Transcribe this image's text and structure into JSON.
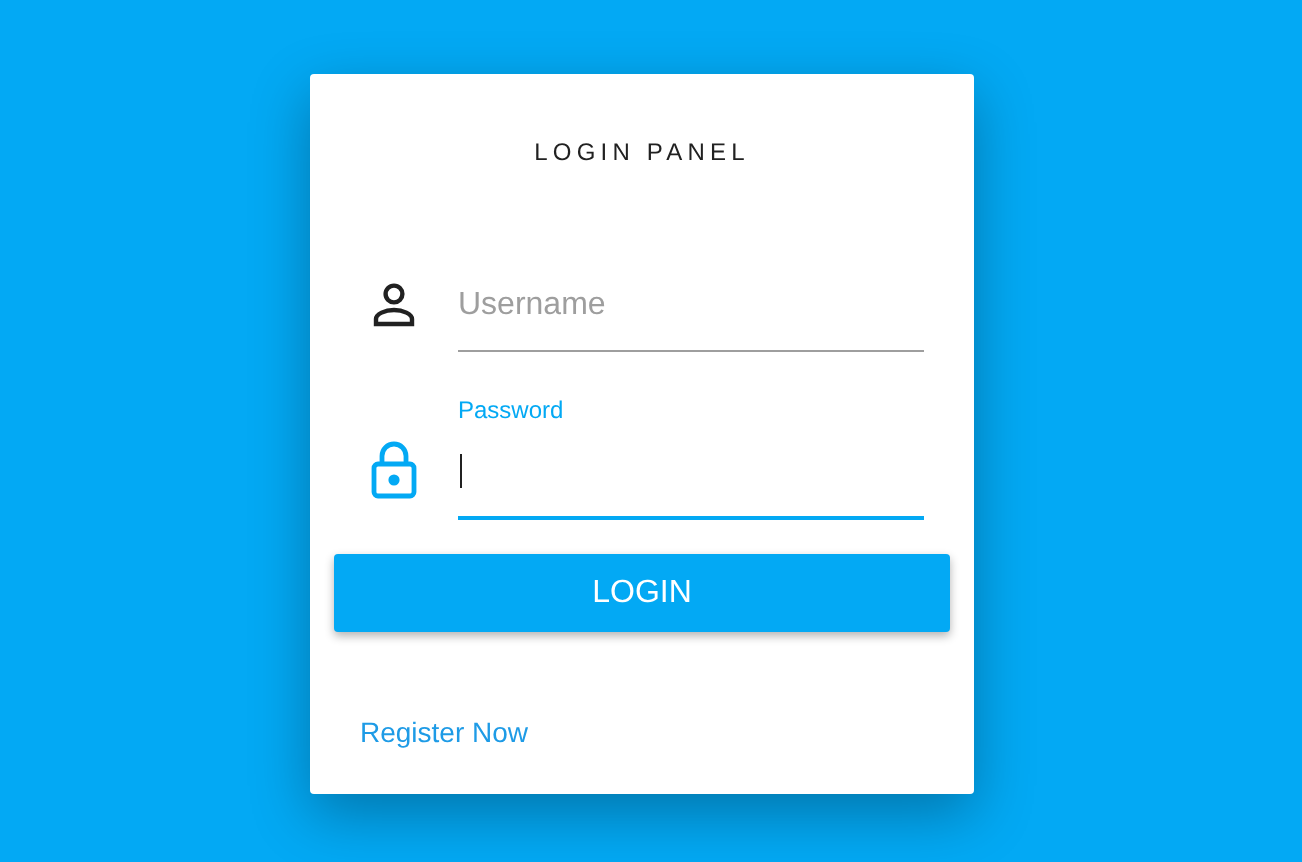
{
  "card": {
    "title": "LOGIN PANEL"
  },
  "fields": [
    {
      "kind": "user",
      "placeholder": "Username",
      "focused": false
    },
    {
      "kind": "lock",
      "label": "Password",
      "focused": true
    }
  ],
  "login_button": "LOGIN",
  "register_link": "Register Now"
}
